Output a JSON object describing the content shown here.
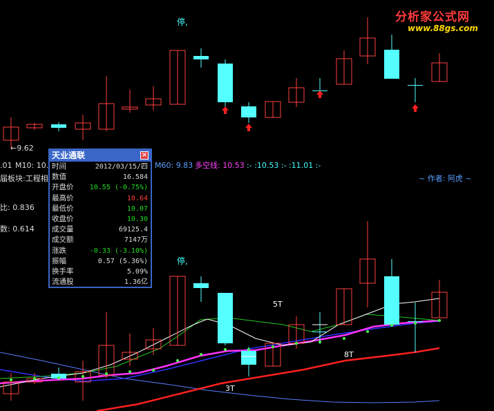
{
  "header": {
    "top_mark": "停,"
  },
  "logo": {
    "title": "分析家公式网",
    "url": "www.88gs.com"
  },
  "upper_panel": {
    "low_marker": "←9.62",
    "ma_prefix": ".01",
    "m10_label": "M10: 10.6",
    "m60_label": "M60: 9.83",
    "kongxian_label": "多空线: 10.53",
    "trail_label": ":- :10.53 :- :11.01 :-",
    "author_label": "~ 作者: 阿虎 ~",
    "sector_label": "届板块:工程相",
    "ratio_label": "比: 0.836",
    "count_label": "数: 0.614"
  },
  "lower_panel": {
    "stop_mark": "停,",
    "label_5t": "5T",
    "label_8t": "8T",
    "label_3t": "3T"
  },
  "popup": {
    "title": "天业通联",
    "close_glyph": "×",
    "rows": [
      {
        "label": "时间",
        "value": "2012/03/15/四",
        "color": "#dcdcdc"
      },
      {
        "label": "数值",
        "value": "16.584",
        "color": "#dcdcdc"
      },
      {
        "label": "开盘价",
        "value": "10.55 (-0.75%)",
        "color": "#22dd22"
      },
      {
        "label": "最高价",
        "value": "10.64",
        "color": "#ff4040"
      },
      {
        "label": "最低价",
        "value": "10.07",
        "color": "#22dd22"
      },
      {
        "label": "收盘价",
        "value": "10.30",
        "color": "#22dd22"
      },
      {
        "label": "成交量",
        "value": "69125.4",
        "color": "#dcdcdc"
      },
      {
        "label": "成交额",
        "value": "7147万",
        "color": "#dcdcdc"
      },
      {
        "label": "涨跌",
        "value": "-0.33 (-3.10%)",
        "color": "#22dd22"
      },
      {
        "label": "振幅",
        "value": "0.57 (5.36%)",
        "color": "#dcdcdc"
      },
      {
        "label": "换手率",
        "value": "5.09%",
        "color": "#dcdcdc"
      },
      {
        "label": "流通股",
        "value": "1.36亿",
        "color": "#dcdcdc"
      }
    ]
  },
  "colors": {
    "up_candle": "#ff4040",
    "down_candle": "#54ffff",
    "ma_pink": "#ff33ff",
    "ma_blue": "#2030ff",
    "ma_red": "#ff2020",
    "ma_white": "#ffffff",
    "ma_green": "#22cc22",
    "m60_text": "#5aa0ff",
    "kongxian_text": "#ff44ff",
    "trail_text": "#44ffff",
    "author_text": "#5aa0ff"
  }
}
